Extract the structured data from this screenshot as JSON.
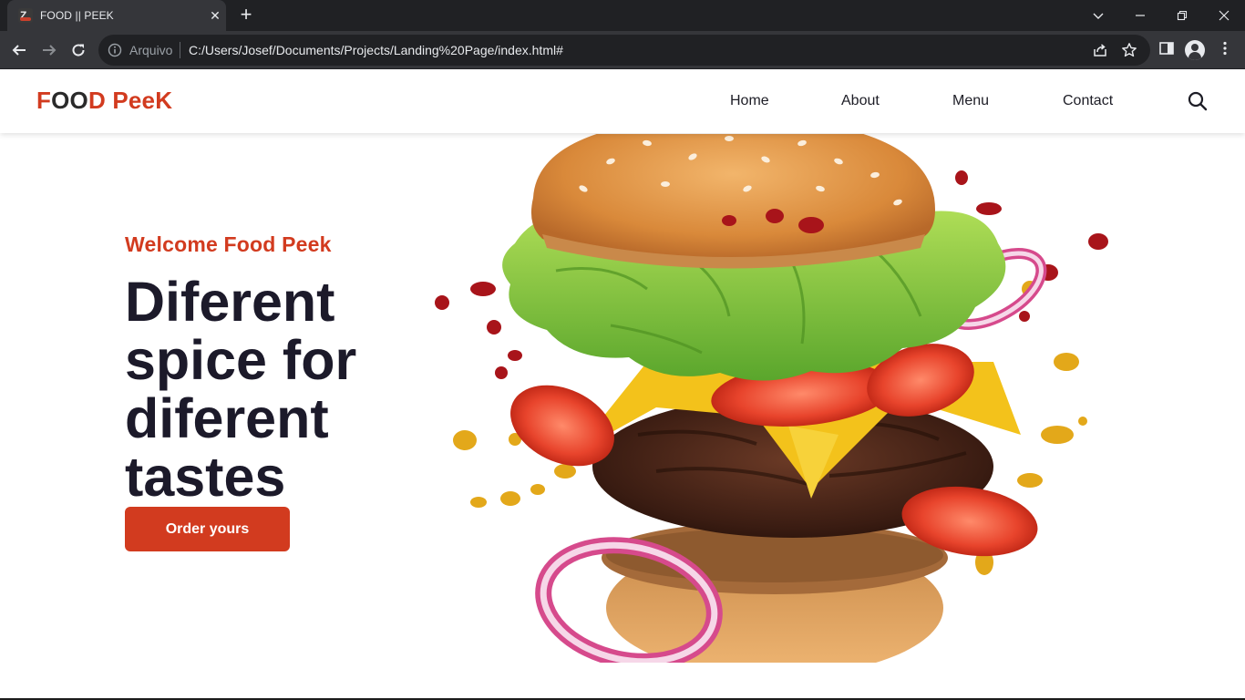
{
  "browser": {
    "tab_title": "FOOD || PEEK",
    "scheme_label": "Arquivo",
    "url": "C:/Users/Josef/Documents/Projects/Landing%20Page/index.html#",
    "colors": {
      "chrome_dark": "#202124",
      "chrome_mid": "#35363a",
      "text": "#e8eaed"
    }
  },
  "site": {
    "logo": {
      "part1": "F",
      "part2": "OO",
      "part3": "D PeeK"
    },
    "nav": [
      {
        "label": "Home"
      },
      {
        "label": "About"
      },
      {
        "label": "Menu"
      },
      {
        "label": "Contact"
      }
    ],
    "hero": {
      "welcome": "Welcome Food Peek",
      "headline": "Diferent spice for diferent tastes",
      "cta": "Order yours",
      "image_icon": "burger-image"
    },
    "colors": {
      "accent": "#d23b1f",
      "heading": "#1c1a2a"
    }
  }
}
